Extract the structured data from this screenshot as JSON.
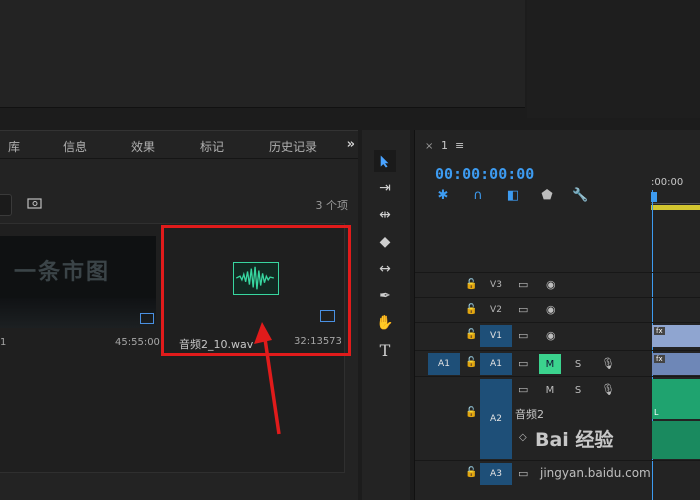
{
  "project_panel": {
    "tabs": [
      "库",
      "信息",
      "效果",
      "标记",
      "历史记录"
    ],
    "overflow": "»",
    "item_count": "3 个项",
    "video_item": {
      "left_number": "1",
      "duration": "45:55:00",
      "title_art": "一条市图"
    },
    "audio_item": {
      "name": "音频2_10.wav",
      "duration": "32:13573"
    }
  },
  "timeline": {
    "close": "×",
    "sequence_name": "1",
    "menu_icon": "≡",
    "timecode": "00:00:00:00",
    "ruler_label": ":00:00",
    "tracks": {
      "v3": "V3",
      "v2": "V2",
      "v1": "V1",
      "a1": "A1",
      "a2": "A2",
      "a3": "A3",
      "a2_clip_name": "音频2",
      "source_a1": "A1",
      "mute": "M",
      "solo": "S"
    }
  },
  "watermark": {
    "brand": "Bai 经验",
    "sub": "jingyan.baidu.com"
  },
  "colors": {
    "accent_blue": "#3d9bf0",
    "highlight_red": "#e01b1b",
    "audio_green": "#1fa36f",
    "track_blue": "#1e4f78"
  }
}
